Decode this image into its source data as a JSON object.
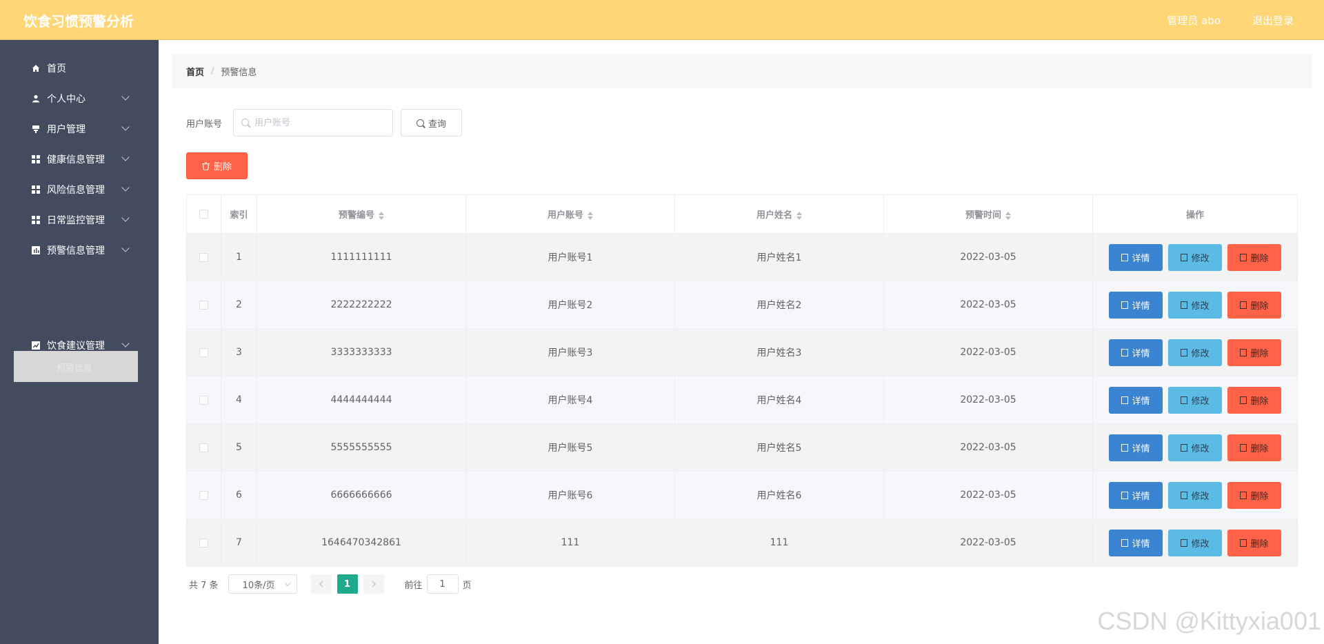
{
  "header": {
    "app_title": "饮食习惯预警分析",
    "user": "管理员 abo",
    "logout": "退出登录"
  },
  "sidebar": {
    "items": [
      {
        "label": "首页",
        "icon": "home-icon",
        "arrow": false
      },
      {
        "label": "个人中心",
        "icon": "user-icon",
        "arrow": true
      },
      {
        "label": "用户管理",
        "icon": "users-icon",
        "arrow": true
      },
      {
        "label": "健康信息管理",
        "icon": "grid-icon",
        "arrow": true
      },
      {
        "label": "风险信息管理",
        "icon": "grid-icon",
        "arrow": true
      },
      {
        "label": "日常监控管理",
        "icon": "grid-icon",
        "arrow": true
      },
      {
        "label": "预警信息管理",
        "icon": "chart-icon",
        "arrow": true
      },
      {
        "label": "饮食建议管理",
        "icon": "chart-icon",
        "arrow": true
      }
    ],
    "active_sub": "预警信息"
  },
  "breadcrumb": {
    "home": "首页",
    "separator": "/",
    "current": "预警信息"
  },
  "search": {
    "label": "用户账号",
    "placeholder": "用户账号",
    "button": "查询"
  },
  "toolbar": {
    "delete_label": "删除"
  },
  "table": {
    "headers": {
      "index": "索引",
      "warn_no": "预警编号",
      "account": "用户账号",
      "name": "用户姓名",
      "time": "预警时间",
      "ops": "操作"
    },
    "rows": [
      {
        "index": "1",
        "warn_no": "1111111111",
        "account": "用户账号1",
        "name": "用户姓名1",
        "time": "2022-03-05"
      },
      {
        "index": "2",
        "warn_no": "2222222222",
        "account": "用户账号2",
        "name": "用户姓名2",
        "time": "2022-03-05"
      },
      {
        "index": "3",
        "warn_no": "3333333333",
        "account": "用户账号3",
        "name": "用户姓名3",
        "time": "2022-03-05"
      },
      {
        "index": "4",
        "warn_no": "4444444444",
        "account": "用户账号4",
        "name": "用户姓名4",
        "time": "2022-03-05"
      },
      {
        "index": "5",
        "warn_no": "5555555555",
        "account": "用户账号5",
        "name": "用户姓名5",
        "time": "2022-03-05"
      },
      {
        "index": "6",
        "warn_no": "6666666666",
        "account": "用户账号6",
        "name": "用户姓名6",
        "time": "2022-03-05"
      },
      {
        "index": "7",
        "warn_no": "1646470342861",
        "account": "111",
        "name": "111",
        "time": "2022-03-05"
      }
    ],
    "actions": {
      "detail": "详情",
      "edit": "修改",
      "delete": "删除"
    }
  },
  "pagination": {
    "total": "共 7 条",
    "page_size": "10条/页",
    "current_page": "1",
    "goto_label": "前往",
    "goto_value": "1",
    "page_unit": "页"
  },
  "watermark": "CSDN @Kittyxia001",
  "colors": {
    "header_bg": "#ffd675",
    "sidebar_bg": "#434b5f",
    "primary": "#3a84d1",
    "info": "#5bbbe5",
    "danger": "#ff6247",
    "page_active": "#1faa8d"
  }
}
